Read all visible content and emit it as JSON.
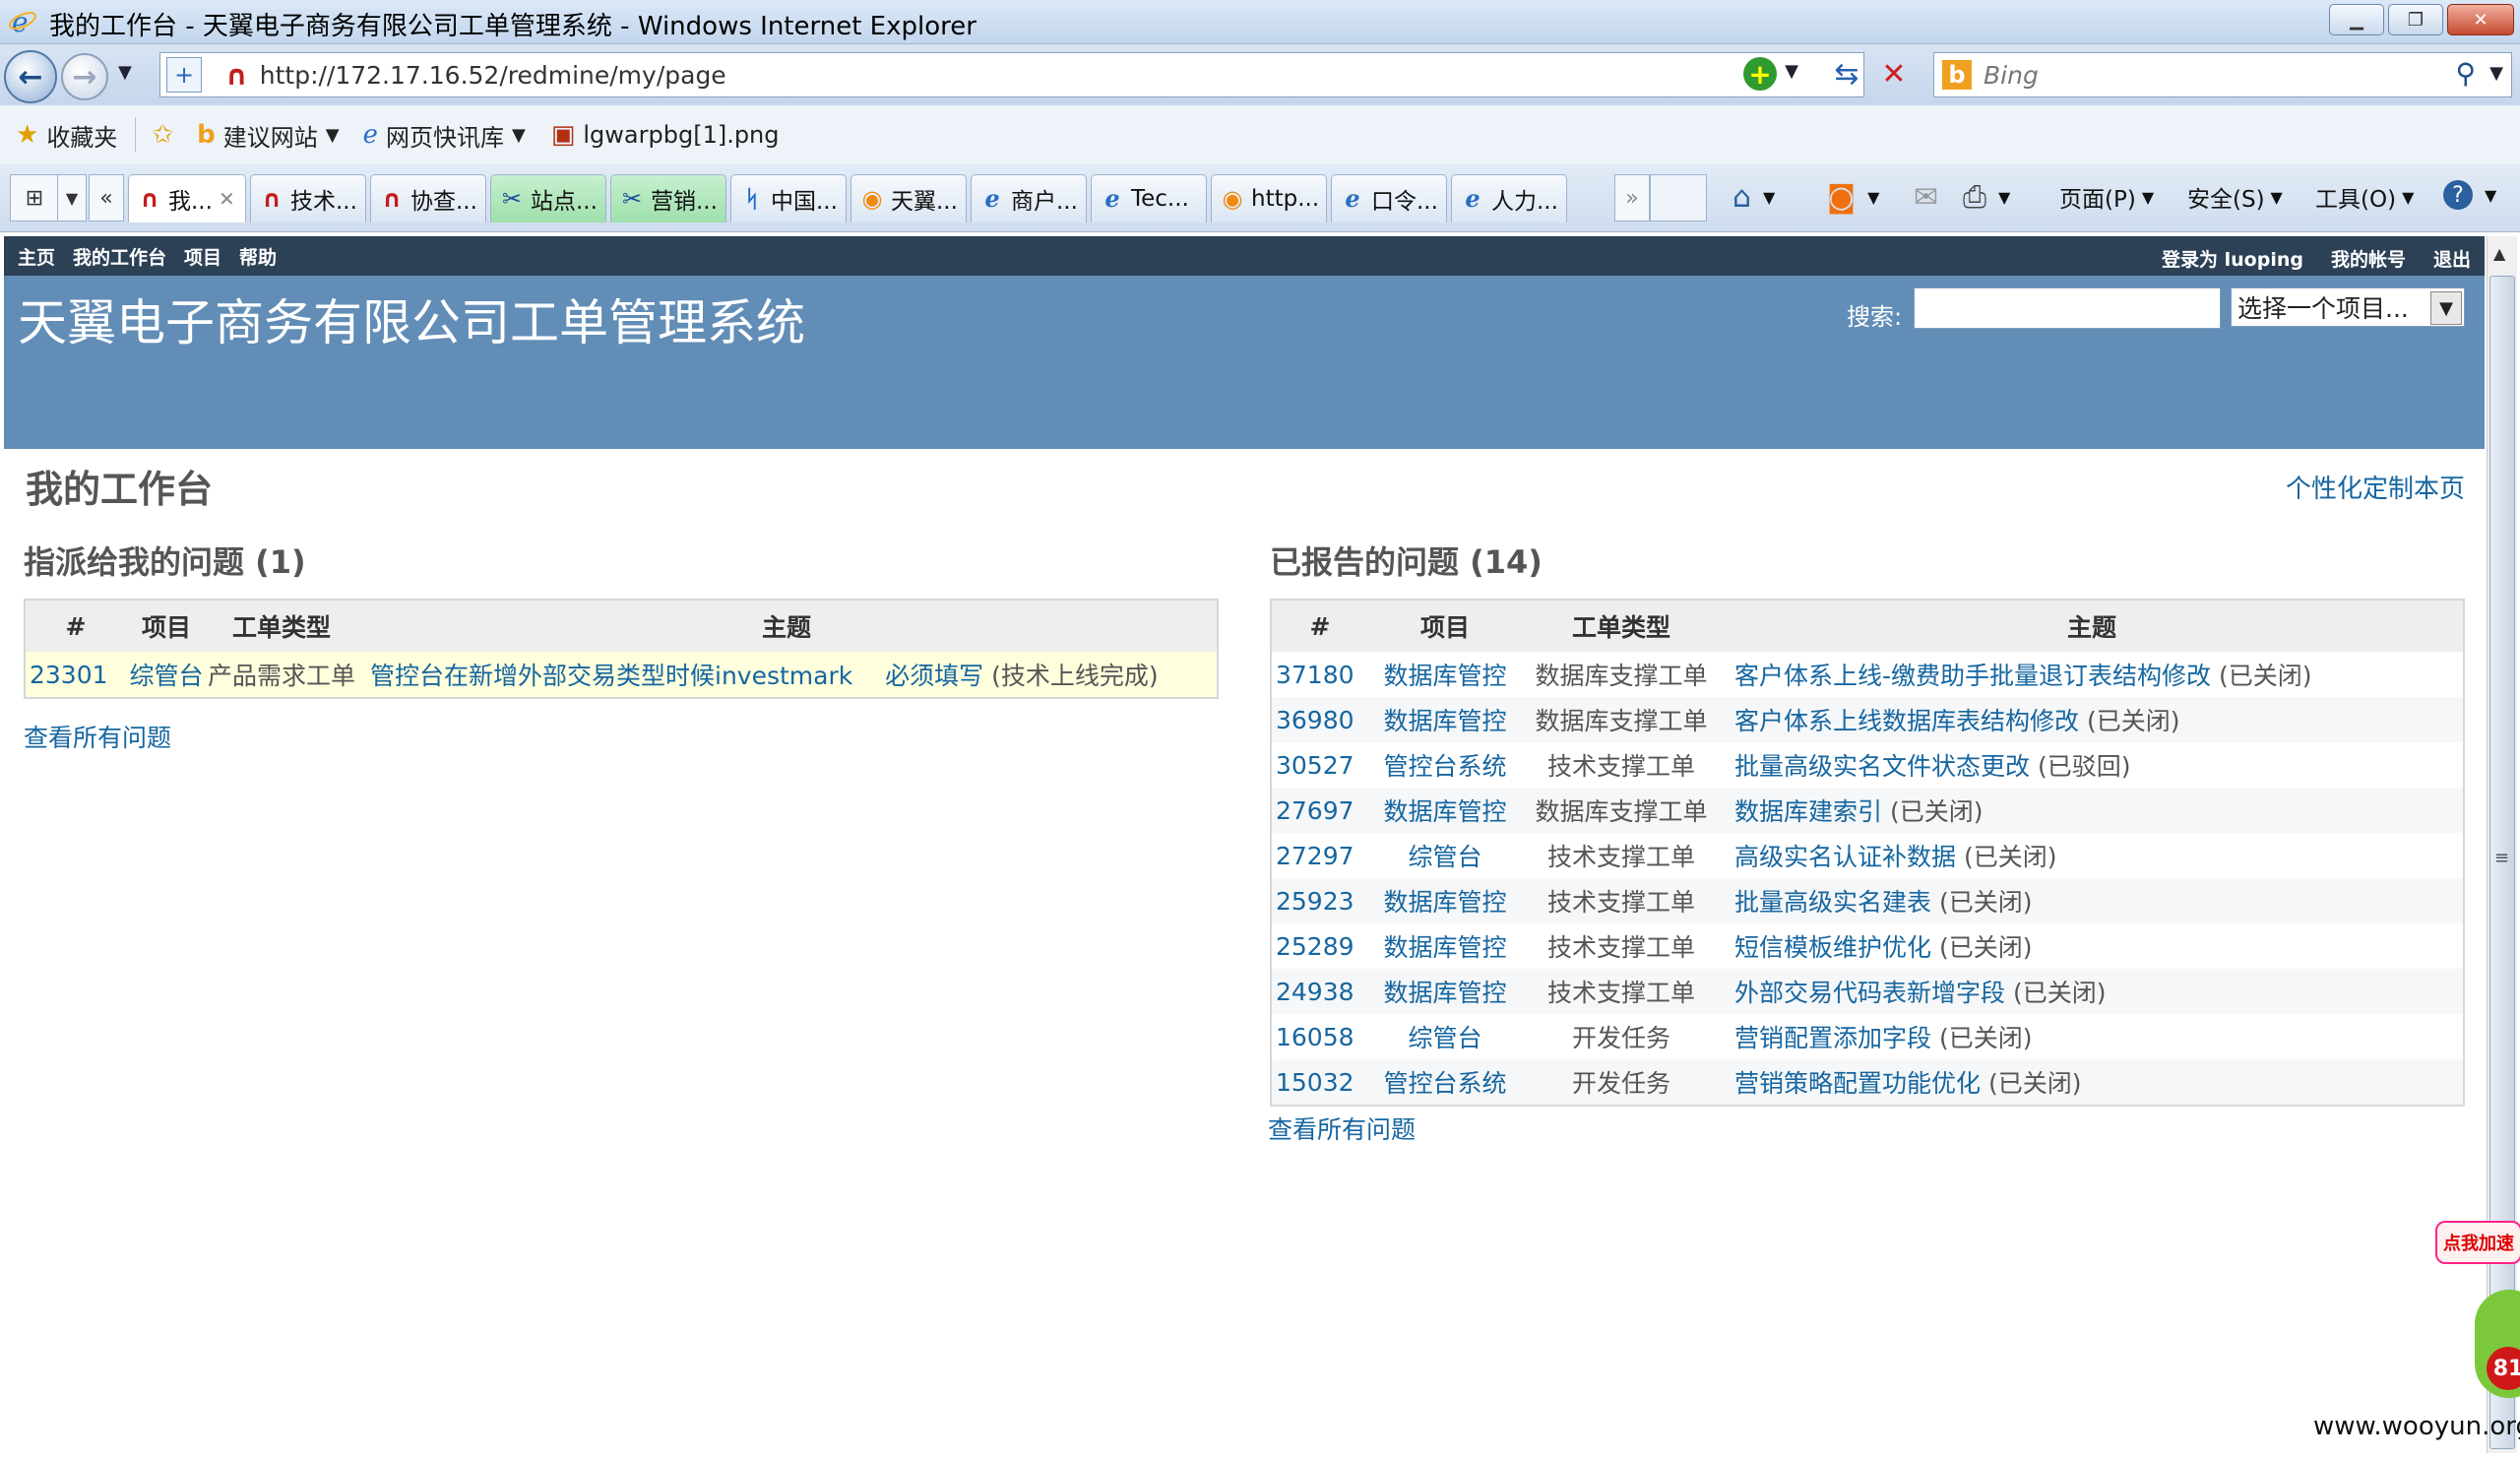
{
  "window": {
    "title": "我的工作台 - 天翼电子商务有限公司工单管理系统 - Windows Internet Explorer",
    "url": "http://172.17.16.52/redmine/my/page",
    "search_placeholder": "Bing"
  },
  "favorites_bar": {
    "favorites": "收藏夹",
    "suggested_sites": "建议网站",
    "web_slice": "网页快讯库",
    "pinned_file": "lgwarpbg[1].png"
  },
  "tabs": [
    {
      "label": "我...",
      "icon": "redmine-icon"
    },
    {
      "label": "技术...",
      "icon": "redmine-icon"
    },
    {
      "label": "协查...",
      "icon": "redmine-icon"
    },
    {
      "label": "站点...",
      "icon": "tools-icon"
    },
    {
      "label": "营销...",
      "icon": "tools-icon"
    },
    {
      "label": "中国...",
      "icon": "telecom-icon"
    },
    {
      "label": "天翼...",
      "icon": "tianyi-icon"
    },
    {
      "label": "商户...",
      "icon": "ie-icon"
    },
    {
      "label": "Tec...",
      "icon": "ie-icon"
    },
    {
      "label": "http...",
      "icon": "tianyi-icon"
    },
    {
      "label": "口令...",
      "icon": "ie-icon"
    },
    {
      "label": "人力...",
      "icon": "ie-icon"
    }
  ],
  "command_bar": {
    "page": "页面(P)",
    "safety": "安全(S)",
    "tools": "工具(O)"
  },
  "redmine": {
    "top_menu": [
      "主页",
      "我的工作台",
      "项目",
      "帮助"
    ],
    "logged_in_as": "登录为",
    "username": "luoping",
    "my_account": "我的帐号",
    "logout": "退出",
    "site_title": "天翼电子商务有限公司工单管理系统",
    "search_label": "搜索:",
    "project_select": "选择一个项目...",
    "page_title": "我的工作台",
    "customize_link": "个性化定制本页",
    "assigned": {
      "title": "指派给我的问题 (1)",
      "headers": [
        "#",
        "项目",
        "工单类型",
        "主题"
      ],
      "rows": [
        {
          "id": "23301",
          "project": "综管台",
          "type": "产品需求工单",
          "subject": "管控台在新增外部交易类型时候investmark　 必须填写",
          "status": "(技术上线完成)"
        }
      ],
      "view_all": "查看所有问题"
    },
    "reported": {
      "title": "已报告的问题 (14)",
      "headers": [
        "#",
        "项目",
        "工单类型",
        "主题"
      ],
      "rows": [
        {
          "id": "37180",
          "project": "数据库管控",
          "type": "数据库支撑工单",
          "subject": "客户体系上线-缴费助手批量退订表结构修改",
          "status": "(已关闭)"
        },
        {
          "id": "36980",
          "project": "数据库管控",
          "type": "数据库支撑工单",
          "subject": "客户体系上线数据库表结构修改",
          "status": "(已关闭)"
        },
        {
          "id": "30527",
          "project": "管控台系统",
          "type": "技术支撑工单",
          "subject": "批量高级实名文件状态更改",
          "status": "(已驳回)"
        },
        {
          "id": "27697",
          "project": "数据库管控",
          "type": "数据库支撑工单",
          "subject": "数据库建索引",
          "status": "(已关闭)"
        },
        {
          "id": "27297",
          "project": "综管台",
          "type": "技术支撑工单",
          "subject": "高级实名认证补数据",
          "status": "(已关闭)"
        },
        {
          "id": "25923",
          "project": "数据库管控",
          "type": "技术支撑工单",
          "subject": "批量高级实名建表",
          "status": "(已关闭)"
        },
        {
          "id": "25289",
          "project": "数据库管控",
          "type": "技术支撑工单",
          "subject": "短信模板维护优化",
          "status": "(已关闭)"
        },
        {
          "id": "24938",
          "project": "数据库管控",
          "type": "技术支撑工单",
          "subject": "外部交易代码表新增字段",
          "status": "(已关闭)"
        },
        {
          "id": "16058",
          "project": "综管台",
          "type": "开发任务",
          "subject": "营销配置添加字段",
          "status": "(已关闭)"
        },
        {
          "id": "15032",
          "project": "管控台系统",
          "type": "开发任务",
          "subject": "营销策略配置功能优化",
          "status": "(已关闭)"
        }
      ],
      "view_all": "查看所有问题"
    }
  },
  "widget": {
    "bubble": "点我加速",
    "count": "81"
  },
  "watermark": "www.wooyun.org"
}
